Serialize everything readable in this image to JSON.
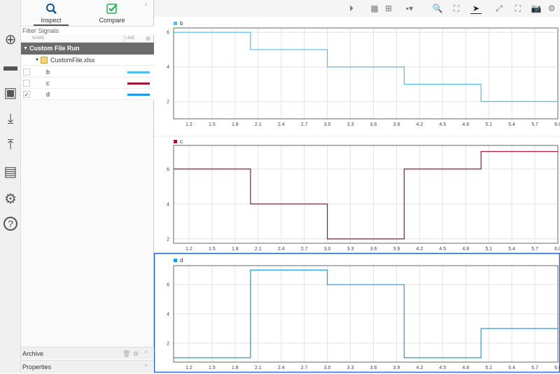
{
  "panel": {
    "tabs": [
      {
        "label": "Inspect",
        "active": true
      },
      {
        "label": "Compare",
        "active": false
      }
    ],
    "filter_placeholder": "Filter Signals",
    "columns": {
      "name": "NAME",
      "line": "LINE"
    },
    "run": "Custom File Run",
    "file": "CustomFile.xlsx",
    "signals": [
      {
        "name": "b",
        "checked": false,
        "color": "#4dbfeb"
      },
      {
        "name": "c",
        "checked": false,
        "color": "#a2142f"
      },
      {
        "name": "d",
        "checked": true,
        "color": "#1a9be8"
      }
    ],
    "check_mark": "✓",
    "archive": "Archive",
    "properties": "Properties"
  },
  "iconbar": [
    "new-icon",
    "open-folder-icon",
    "save-icon",
    "import-icon",
    "export-icon",
    "report-icon",
    "settings-icon",
    "help-icon"
  ],
  "toolbar": [
    "replay-icon",
    "layout-icon",
    "subplot-grid-icon",
    "visualization-icon",
    "zoom-in-icon",
    "fit-to-view-icon",
    "cursor-icon",
    "expand-icon",
    "fullscreen-icon",
    "snapshot-icon",
    "settings-icon"
  ],
  "chart_data": [
    {
      "type": "line",
      "step": true,
      "legend": "b",
      "color": "#4dbfeb",
      "x": [
        1,
        2,
        2,
        3,
        3,
        4,
        4,
        5,
        5,
        6
      ],
      "y": [
        6,
        6,
        5,
        5,
        4,
        4,
        3,
        3,
        2,
        2
      ],
      "xlim": [
        1,
        6
      ],
      "ylim": [
        1,
        6.25
      ],
      "xticks": [
        1.2,
        1.5,
        1.8,
        2.1,
        2.4,
        2.7,
        3.0,
        3.3,
        3.6,
        3.9,
        4.2,
        4.5,
        4.8,
        5.1,
        5.4,
        5.7,
        6.0
      ],
      "yticks": [
        2,
        4,
        6
      ],
      "grid": true
    },
    {
      "type": "line",
      "step": true,
      "legend": "c",
      "color": "#a2142f",
      "x": [
        1,
        2,
        2,
        3,
        3,
        4,
        4,
        5,
        5,
        6
      ],
      "y": [
        6,
        6,
        4,
        4,
        2,
        2,
        6,
        6,
        7,
        7
      ],
      "xlim": [
        1,
        6
      ],
      "ylim": [
        1.75,
        7.35
      ],
      "xticks": [
        1.2,
        1.5,
        1.8,
        2.1,
        2.4,
        2.7,
        3.0,
        3.3,
        3.6,
        3.9,
        4.2,
        4.5,
        4.8,
        5.1,
        5.4,
        5.7,
        6.0
      ],
      "yticks": [
        2,
        4,
        6
      ],
      "grid": true
    },
    {
      "type": "line",
      "step": true,
      "legend": "d",
      "color": "#1a9be8",
      "selected": true,
      "x": [
        1,
        2,
        2,
        3,
        3,
        4,
        4,
        5,
        5,
        6
      ],
      "y": [
        1,
        1,
        7,
        7,
        6,
        6,
        1,
        1,
        3,
        3
      ],
      "xlim": [
        1,
        6
      ],
      "ylim": [
        0.7,
        7.3
      ],
      "xticks": [
        1.2,
        1.5,
        1.8,
        2.1,
        2.4,
        2.7,
        3.0,
        3.3,
        3.6,
        3.9,
        4.2,
        4.5,
        4.8,
        5.1,
        5.4,
        5.7,
        6.0
      ],
      "yticks": [
        2,
        4,
        6
      ],
      "grid": true
    }
  ]
}
